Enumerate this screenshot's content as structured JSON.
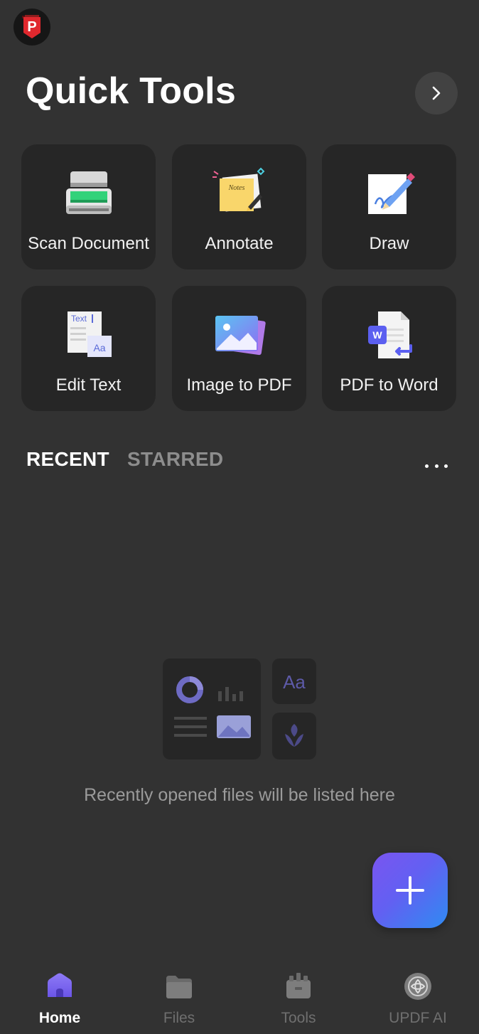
{
  "header": {
    "avatar_letter": "P",
    "title": "Quick Tools"
  },
  "quick_tools": [
    {
      "label": "Scan Document",
      "icon": "scanner-icon"
    },
    {
      "label": "Annotate",
      "icon": "notes-icon",
      "icon_text": "Notes"
    },
    {
      "label": "Draw",
      "icon": "draw-icon"
    },
    {
      "label": "Edit Text",
      "icon": "edit-text-icon",
      "icon_text_1": "Text",
      "icon_text_2": "Aa"
    },
    {
      "label": "Image to PDF",
      "icon": "image-icon"
    },
    {
      "label": "PDF to Word",
      "icon": "word-doc-icon",
      "icon_text": "W"
    }
  ],
  "tabs": {
    "recent": "RECENT",
    "starred": "STARRED",
    "active": "recent"
  },
  "empty_state": {
    "illustration_text": "Aa",
    "message": "Recently opened files will be listed here"
  },
  "bottom_nav": [
    {
      "label": "Home",
      "icon": "home-icon",
      "active": true
    },
    {
      "label": "Files",
      "icon": "folder-icon",
      "active": false
    },
    {
      "label": "Tools",
      "icon": "toolbox-icon",
      "active": false
    },
    {
      "label": "UPDF AI",
      "icon": "ai-icon",
      "active": false
    }
  ],
  "colors": {
    "background": "#323232",
    "card": "#262626",
    "accent": "#6b5cf2",
    "fab_gradient_start": "#7a55f0",
    "fab_gradient_end": "#2f8bf2"
  }
}
